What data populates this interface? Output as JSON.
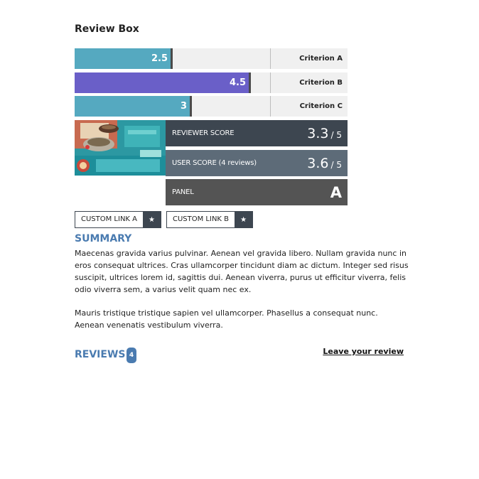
{
  "title": "Review Box",
  "criteria": [
    {
      "label": "Criterion A",
      "value": "2.5",
      "color": "#55a9c0",
      "fraction": 0.5
    },
    {
      "label": "Criterion B",
      "value": "4.5",
      "color": "#6a5fc8",
      "fraction": 0.9
    },
    {
      "label": "Criterion C",
      "value": "3",
      "color": "#55a9c0",
      "fraction": 0.6
    }
  ],
  "reviewer_score": {
    "label": "REVIEWER SCORE",
    "value": "3.3",
    "max": "/ 5",
    "color": "#3d4650"
  },
  "user_score": {
    "label": "USER SCORE (4 reviews)",
    "value": "3.6",
    "max": "/ 5",
    "color": "#5d6b78"
  },
  "panel": {
    "label": "PANEL",
    "grade": "A",
    "color": "#545454"
  },
  "custom_links": [
    {
      "label": "CUSTOM LINK A",
      "icon": "star-icon"
    },
    {
      "label": "CUSTOM LINK B",
      "icon": "star-icon"
    }
  ],
  "summary": {
    "heading": "SUMMARY",
    "paragraphs": [
      "Maecenas gravida varius pulvinar. Aenean vel gravida libero. Nullam gravida nunc in eros consequat ultrices. Cras ullamcorper tincidunt diam ac dictum. Integer sed risus suscipit, ultrices lorem id, sagittis dui. Aenean viverra, purus ut efficitur viverra, felis odio viverra sem, a varius velit quam nec ex.",
      "Mauris tristique tristique sapien vel ullamcorper. Phasellus a consequat nunc. Aenean venenatis vestibulum viverra."
    ]
  },
  "reviews": {
    "heading": "REVIEWS",
    "count": "4",
    "leave_label": "Leave your review"
  },
  "accent_color": "#4a7bb0"
}
